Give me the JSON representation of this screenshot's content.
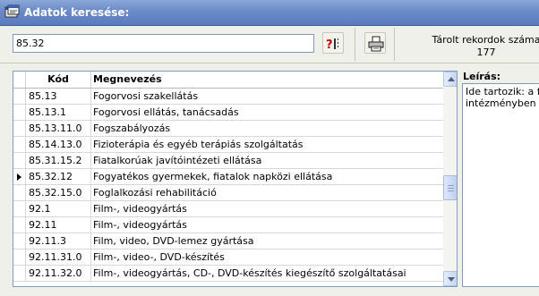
{
  "window": {
    "title": "Adatok keresése:"
  },
  "search": {
    "value": "85.32"
  },
  "stored_records": {
    "label": "Tárolt rekordok száma",
    "count": "177"
  },
  "grid": {
    "columns": {
      "code": "Kód",
      "name": "Megnevezés"
    },
    "current_row_index": 5,
    "rows": [
      {
        "code": "85.13",
        "name": "Fogorvosi szakellátás"
      },
      {
        "code": "85.13.1",
        "name": "Fogorvosi ellátás, tanácsadás"
      },
      {
        "code": "85.13.11.0",
        "name": "Fogszabályozás"
      },
      {
        "code": "85.14.13.0",
        "name": "Fizioterápia és egyéb terápiás szolgáltatás"
      },
      {
        "code": "85.31.15.2",
        "name": "Fiatalkorúak javítóintézeti ellátása"
      },
      {
        "code": "85.32.12",
        "name": "Fogyatékos gyermekek, fiatalok napközi ellátása"
      },
      {
        "code": "85.32.15.0",
        "name": "Foglalkozási rehabilitáció"
      },
      {
        "code": "92.1",
        "name": "Film-, videogyártás"
      },
      {
        "code": "92.11",
        "name": "Film-, videogyártás"
      },
      {
        "code": "92.11.3",
        "name": "Film, video, DVD-lemez gyártása"
      },
      {
        "code": "92.11.31.0",
        "name": "Film-, video-, DVD-készítés"
      },
      {
        "code": "92.11.32.0",
        "name": "Film-, videogyártás, CD-, DVD-készítés kiegészítő szolgáltatásai"
      }
    ]
  },
  "description": {
    "label": "Leírás:",
    "text": "Ide tartozik: a fogyatékos\nintézményben történő"
  },
  "icons": {
    "app": "app-window-icon",
    "search": "question-search-icon",
    "print": "printer-icon"
  },
  "colors": {
    "titlebar": "#6a8ac8",
    "title_text": "#ffffff",
    "field_border": "#7f9db9",
    "question_mark": "#cc0000"
  }
}
